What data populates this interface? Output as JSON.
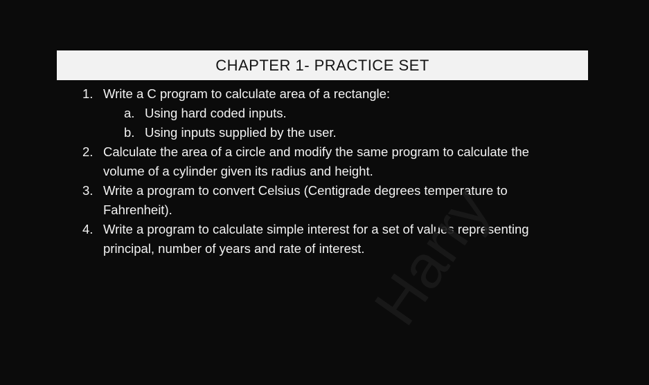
{
  "header": {
    "title": "CHAPTER 1- PRACTICE SET"
  },
  "items": [
    {
      "number": "1.",
      "lines": [
        "Write a C program to calculate area of a rectangle:"
      ],
      "sub_items": [
        {
          "letter": "a.",
          "text": "Using hard coded inputs."
        },
        {
          "letter": "b.",
          "text": "Using inputs supplied by the user."
        }
      ]
    },
    {
      "number": "2.",
      "lines": [
        "Calculate the area of a circle and modify the same program to calculate the",
        "volume of a cylinder given its radius and height."
      ]
    },
    {
      "number": "3.",
      "lines": [
        "Write a program to convert Celsius (Centigrade degrees temperature to",
        "Fahrenheit)."
      ]
    },
    {
      "number": "4.",
      "lines": [
        "Write a program to calculate simple interest for a set of values representing",
        "principal, number of years and rate of interest."
      ]
    }
  ],
  "watermark": {
    "text": "Harry"
  }
}
